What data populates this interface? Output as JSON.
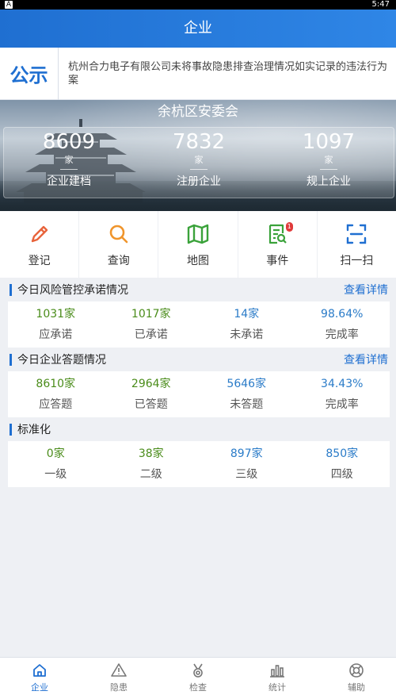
{
  "status_bar": {
    "time": "5:47",
    "left_icon": "A"
  },
  "header": {
    "title": "企业"
  },
  "notice": {
    "tag": "公示",
    "text": "杭州合力电子有限公司未将事故隐患排查治理情况如实记录的违法行为案"
  },
  "banner": {
    "title": "余杭区安委会",
    "stats": [
      {
        "number": "8609",
        "unit": "家",
        "label": "企业建档"
      },
      {
        "number": "7832",
        "unit": "家",
        "label": "注册企业"
      },
      {
        "number": "1097",
        "unit": "家",
        "label": "规上企业"
      }
    ]
  },
  "shortcuts": [
    {
      "label": "登记",
      "icon": "pencil-icon",
      "color": "#e8643c"
    },
    {
      "label": "查询",
      "icon": "search-icon",
      "color": "#f0952c"
    },
    {
      "label": "地图",
      "icon": "map-icon",
      "color": "#3aa23a"
    },
    {
      "label": "事件",
      "icon": "event-doc-icon",
      "color": "#3aa23a",
      "badge": "1"
    },
    {
      "label": "扫一扫",
      "icon": "scan-icon",
      "color": "#1f6fd1"
    }
  ],
  "risk": {
    "title": "今日风险管控承诺情况",
    "more": "查看详情",
    "cells": [
      {
        "value": "1031家",
        "label": "应承诺"
      },
      {
        "value": "1017家",
        "label": "已承诺"
      },
      {
        "value": "14家",
        "label": "未承诺"
      },
      {
        "value": "98.64%",
        "label": "完成率"
      }
    ]
  },
  "answers": {
    "title": "今日企业答题情况",
    "more": "查看详情",
    "cells": [
      {
        "value": "8610家",
        "label": "应答题"
      },
      {
        "value": "2964家",
        "label": "已答题"
      },
      {
        "value": "5646家",
        "label": "未答题"
      },
      {
        "value": "34.43%",
        "label": "完成率"
      }
    ]
  },
  "standard": {
    "title": "标准化",
    "cells": [
      {
        "value": "0家",
        "label": "一级"
      },
      {
        "value": "38家",
        "label": "二级"
      },
      {
        "value": "897家",
        "label": "三级"
      },
      {
        "value": "850家",
        "label": "四级"
      }
    ]
  },
  "tabs": [
    {
      "label": "企业",
      "icon": "home-icon",
      "active": true
    },
    {
      "label": "隐患",
      "icon": "warning-icon",
      "active": false
    },
    {
      "label": "检查",
      "icon": "medal-icon",
      "active": false
    },
    {
      "label": "统计",
      "icon": "bar-chart-icon",
      "active": false
    },
    {
      "label": "辅助",
      "icon": "lifebuoy-icon",
      "active": false
    }
  ],
  "colors": {
    "primary": "#1f6fd1",
    "green_value": "#4a8c1a",
    "blue_value": "#2a7bc8",
    "badge": "#e03a3a"
  }
}
